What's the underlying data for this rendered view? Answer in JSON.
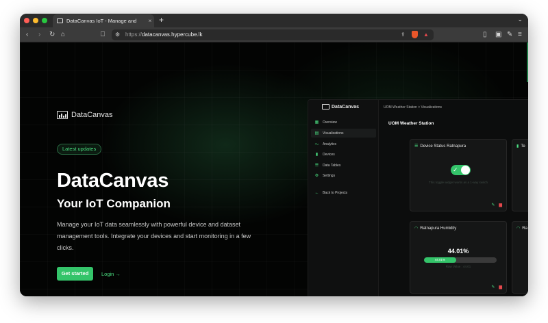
{
  "browser": {
    "tab_title": "DataCanvas IoT - Manage and",
    "new_tab_glyph": "+",
    "tab_close_glyph": "×",
    "url_scheme": "https://",
    "url_host": "datacanvas.hypercube.lk",
    "colors": {
      "close": "#ff5f57",
      "minimize": "#febc2e",
      "maximize": "#28c840"
    }
  },
  "hero": {
    "brand_name": "DataCanvas",
    "badge": "Latest updates",
    "title": "DataCanvas",
    "subtitle": "Your IoT Companion",
    "description": "Manage your IoT data seamlessly with powerful device and dataset management tools. Integrate your devices and start monitoring in a few clicks.",
    "cta_primary": "Get started",
    "cta_secondary": "Login →",
    "accent_color": "#34c46a"
  },
  "dashboard": {
    "brand_name": "DataCanvas",
    "breadcrumb": "UOM Weather Station > Visualizations",
    "title": "UOM Weather Station",
    "nav": [
      {
        "label": "Overview",
        "icon": "grid-icon"
      },
      {
        "label": "Visualizations",
        "icon": "chart-icon",
        "active": true
      },
      {
        "label": "Analytics",
        "icon": "trend-icon"
      },
      {
        "label": "Devices",
        "icon": "device-icon"
      },
      {
        "label": "Data Tables",
        "icon": "table-icon"
      },
      {
        "label": "Settings",
        "icon": "settings-icon"
      }
    ],
    "back_label": "Back to Projects",
    "card_device": {
      "title": "Device Status Ratnapura",
      "hint": "This toggle widget works as a 1-way switch",
      "toggle_on": true
    },
    "card_humidity": {
      "title": "Ratnapura Humidity",
      "value": "44.01%",
      "bar_label": "44.01%",
      "fraction": 0.4401,
      "raw_value": "Raw Value : 44.01"
    },
    "partial_card_top": "Te",
    "partial_card_bottom": "Ra"
  }
}
